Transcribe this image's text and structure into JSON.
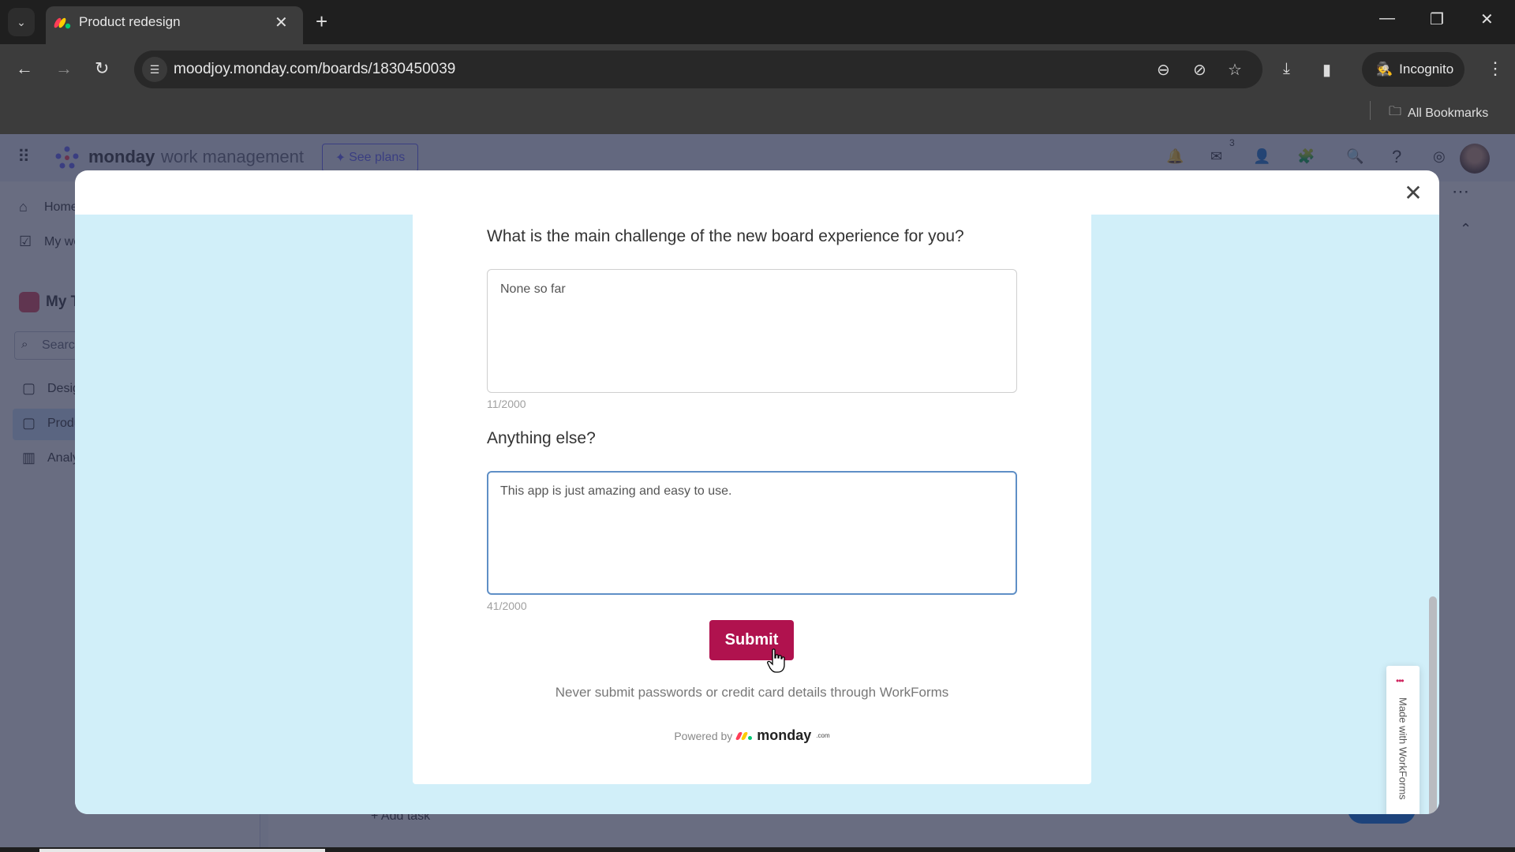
{
  "browser": {
    "tab_title": "Product redesign",
    "url": "moodjoy.monday.com/boards/1830450039",
    "profile_label": "Incognito",
    "bookmarks_label": "All Bookmarks",
    "icons": {
      "tab_search": "chevron-down-icon",
      "new_tab": "plus-icon",
      "back": "arrow-left-icon",
      "forward": "arrow-right-icon",
      "reload": "reload-icon",
      "zoom": "zoom-out-icon",
      "tracking": "eye-slash-icon",
      "bookmark": "star-icon",
      "download": "download-icon",
      "side_panel": "side-panel-icon",
      "menu": "kebab-menu-icon"
    },
    "glyphs": {
      "tab_search": "⌄",
      "tab_close": "✕",
      "new_tab": "+",
      "minimize": "—",
      "restore": "❐",
      "close": "✕",
      "back": "←",
      "forward": "→",
      "reload": "↻",
      "site_info": "☰",
      "zoom": "⊖",
      "tracking": "⊘",
      "bookmark": "☆",
      "download": "⤓",
      "side_panel": "▮",
      "incognito": "🕵",
      "menu": "⋮",
      "folder": "🗀"
    }
  },
  "app": {
    "brand": "monday",
    "product": "work management",
    "see_plans_label": "See plans",
    "inbox_count": "3",
    "sidebar": {
      "home": "Home",
      "my_work": "My work",
      "workspace": "My Team",
      "search_placeholder": "Search",
      "boards": [
        "Design",
        "Product redesign",
        "Analytics"
      ]
    },
    "add_task_label": "+ Add task",
    "glyphs": {
      "apps_grid": "⠿",
      "bell": "🔔",
      "inbox": "✉",
      "invite": "👤",
      "apps": "🧩",
      "search": "🔍",
      "help": "?",
      "more": "⋯",
      "collapse": "⌃"
    }
  },
  "modal": {
    "close_glyph": "✕",
    "form": {
      "questions": [
        {
          "label": "What is the main challenge of the new board experience for you?",
          "value": "None so far",
          "counter": "11/2000",
          "focused": false
        },
        {
          "label": "Anything else?",
          "value": "This app is just amazing and easy to use.",
          "counter": "41/2000",
          "focused": true
        }
      ],
      "submit_label": "Submit",
      "disclaimer": "Never submit passwords or credit card details through WorkForms",
      "powered_by_label": "Powered by",
      "powered_by_brand": "monday",
      "powered_by_suffix": ".com"
    },
    "side_badge": {
      "text": "Made with WorkForms"
    },
    "colors": {
      "submit_bg": "#b0124e",
      "form_bg": "#d1eff9",
      "focus_border": "#5f8fc6"
    }
  }
}
